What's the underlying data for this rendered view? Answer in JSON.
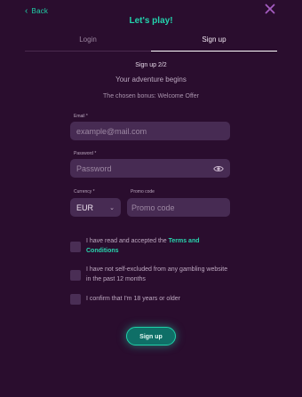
{
  "header": {
    "back_label": "Back",
    "title": "Let's play!"
  },
  "tabs": [
    {
      "label": "Login",
      "active": false
    },
    {
      "label": "Sign up",
      "active": true
    }
  ],
  "form": {
    "step": "Sign up 2/2",
    "subtitle": "Your adventure begins",
    "bonus_text": "The chosen bonus: Welcome Offer",
    "email": {
      "label": "Email *",
      "placeholder": "example@mail.com",
      "value": ""
    },
    "password": {
      "label": "Password *",
      "placeholder": "Password",
      "value": ""
    },
    "currency": {
      "label": "Currency *",
      "value": "EUR"
    },
    "promo": {
      "label": "Promo code",
      "placeholder": "Promo code",
      "value": ""
    },
    "checkboxes": [
      {
        "text": "I have read and accepted the ",
        "link": "Terms and Conditions",
        "checked": false
      },
      {
        "text": "I have not self-excluded from any gambling website in the past 12 months",
        "checked": false
      },
      {
        "text": "I confirm that I'm 18 years or older",
        "checked": false
      }
    ],
    "submit_label": "Sign up"
  },
  "colors": {
    "background": "#2a0d2e",
    "accent": "#1fd1a8",
    "field": "#472b53",
    "close": "#a45cc0"
  },
  "icons": {
    "back": "chevron-left-icon",
    "close": "close-icon",
    "eye": "eye-icon",
    "dropdown": "chevron-down-icon"
  }
}
